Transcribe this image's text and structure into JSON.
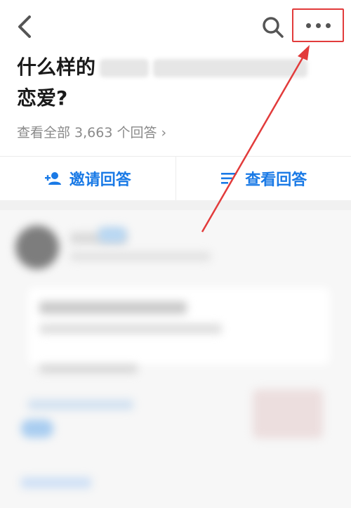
{
  "header": {
    "title_line1": "什么样的",
    "title_line2": "恋爱?",
    "view_all_label": "查看全部 3,663 个回答",
    "view_all_chevron": "›"
  },
  "actions": {
    "invite_label": "邀请回答",
    "view_label": "查看回答"
  },
  "icons": {
    "back": "back-chevron-icon",
    "search": "search-icon",
    "more": "more-dots-icon",
    "invite": "add-person-icon",
    "list": "sort-list-icon"
  },
  "colors": {
    "accent": "#1a7ae6",
    "highlight": "#e23b3b",
    "muted_text": "#8a8a8a"
  }
}
